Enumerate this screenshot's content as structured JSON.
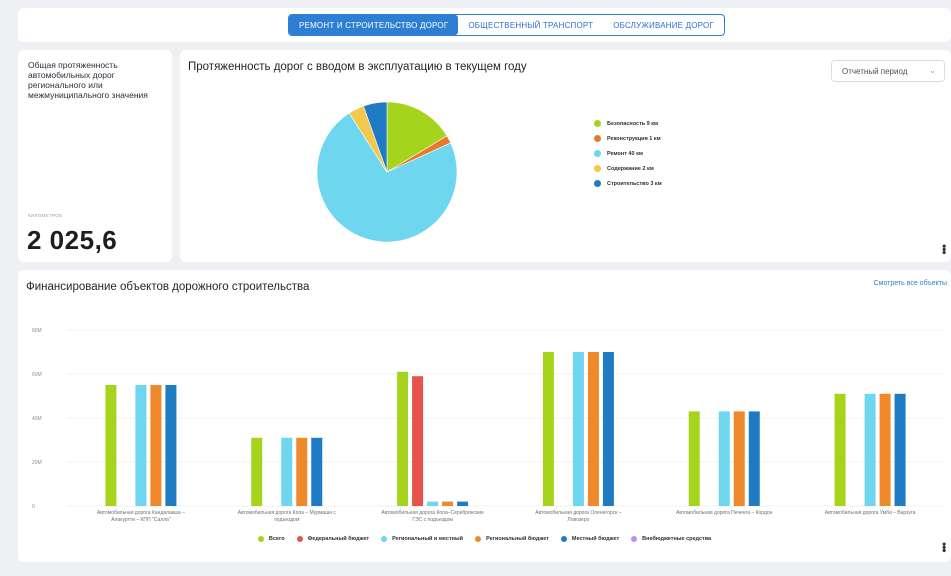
{
  "tabs": [
    {
      "label": "РЕМОНТ И СТРОИТЕЛЬСТВО ДОРОГ",
      "active": true
    },
    {
      "label": "ОБЩЕСТВЕННЫЙ ТРАНСПОРТ",
      "active": false
    },
    {
      "label": "ОБСЛУЖИВАНИЕ ДОРОГ",
      "active": false
    }
  ],
  "summary": {
    "description": "Общая протяженность автомобильных дорог регионального или межмуниципального значения",
    "unit": "КИЛОМЕТРОВ",
    "value": "2 025,6"
  },
  "pie_card": {
    "title": "Протяженность дорог с вводом в эксплуатацию в текущем году",
    "period_placeholder": "Отчетный период",
    "legend": [
      {
        "label": "Безопасность 9 км",
        "color": "#a6d41d"
      },
      {
        "label": "Реконструкция 1 км",
        "color": "#e8782a"
      },
      {
        "label": "Ремонт 40 км",
        "color": "#6fd6ef"
      },
      {
        "label": "Содержание 2 км",
        "color": "#f2c94c"
      },
      {
        "label": "Строительство 3 км",
        "color": "#1e7bc4"
      }
    ]
  },
  "bar_card": {
    "title": "Финансирование объектов дорожного строительства",
    "see_all": "Смотреть все объекты"
  },
  "chart_data": [
    {
      "type": "pie",
      "categories": [
        "Безопасность",
        "Реконструкция",
        "Ремонт",
        "Содержание",
        "Строительство"
      ],
      "values": [
        9,
        1,
        40,
        2,
        3
      ],
      "unit": "км",
      "colors": [
        "#a6d41d",
        "#e8782a",
        "#6fd6ef",
        "#f2c94c",
        "#1e7bc4"
      ]
    },
    {
      "type": "bar",
      "categories": [
        "Автомобильная дорога Кандалакша – Алакуртти – КПП \"Салла\"",
        "Автомобильная дорога Кола – Мурмаши с подъездом",
        "Автомобильная дорога Кола–Серебрянские ГЭС с подъездом",
        "Автомобильная дорога Оленегорск – Ловозеро",
        "Автомобильная дорога Печенга – Кордон",
        "Автомобильная дорога Умба – Варзуга"
      ],
      "yticks": [
        "0",
        "20M",
        "40M",
        "60M",
        "80M"
      ],
      "ylim": [
        0,
        80
      ],
      "legend_placement": "bottom",
      "series": [
        {
          "name": "Всего",
          "color": "#a6d41d",
          "values": [
            55,
            31,
            61,
            70,
            43,
            51
          ]
        },
        {
          "name": "Федеральный бюджет",
          "color": "#e5534b",
          "values": [
            0,
            0,
            59,
            0,
            0,
            0
          ]
        },
        {
          "name": "Региональный и местный",
          "color": "#6fd6ef",
          "values": [
            55,
            31,
            2,
            70,
            43,
            51
          ]
        },
        {
          "name": "Региональный бюджет",
          "color": "#f0892a",
          "values": [
            55,
            31,
            2,
            70,
            43,
            51
          ]
        },
        {
          "name": "Местный бюджет",
          "color": "#1e7bc4",
          "values": [
            55,
            31,
            2,
            70,
            43,
            51
          ]
        },
        {
          "name": "Внебюджетные средства",
          "color": "#c08cf0",
          "values": [
            0,
            0,
            0,
            0,
            0,
            0
          ]
        }
      ]
    }
  ]
}
